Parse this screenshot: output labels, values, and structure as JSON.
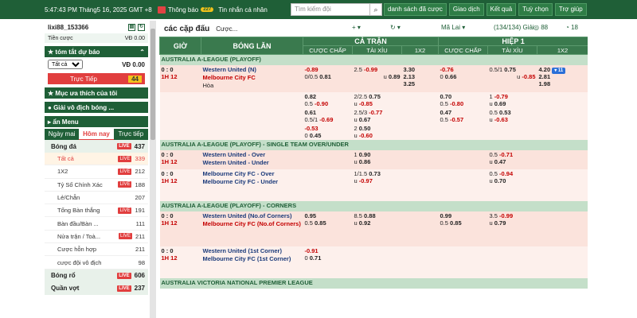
{
  "topbar": {
    "time": "5:47:43 PM Tháng5 16, 2025 GMT +8",
    "notif": "Thông báo",
    "notif_count": "227",
    "msg": "Tin nhắn cá nhân",
    "search_ph": "Tìm kiếm đội",
    "nav": [
      "danh sách đã cược",
      "Giao dịch",
      "Kết quả",
      "Tuỳ chọn",
      "Trợ giúp"
    ]
  },
  "account": {
    "user": "lixi88_153366",
    "credit_label": "Tiền cược",
    "credit_value": "VĐ 0.00"
  },
  "slip": {
    "title": "tóm tắt dự báo",
    "select": "Tất cả",
    "value": "VĐ 0.00",
    "live_label": "Trực Tiếp",
    "live_count": "44"
  },
  "sections": {
    "fav": "Mục ưa thích của tôi",
    "champ": "Giải vô địch bóng ...",
    "menu": "ẩn Menu"
  },
  "tabs": [
    "Ngày mai",
    "Hôm nay",
    "Trực tiếp"
  ],
  "sports": [
    {
      "name": "Bóng đá",
      "count": "437"
    },
    {
      "name": "Bóng rổ",
      "count": "606"
    },
    {
      "name": "Quần vợt",
      "count": "237"
    }
  ],
  "subs": [
    {
      "name": "Tất cả",
      "count": "339",
      "live": true
    },
    {
      "name": "1X2",
      "count": "212",
      "live": true
    },
    {
      "name": "Tỷ Số Chính Xác",
      "count": "188",
      "live": true
    },
    {
      "name": "Lẻ/Chẵn",
      "count": "207",
      "live": false
    },
    {
      "name": "Tổng Bàn thắng",
      "count": "191",
      "live": true
    },
    {
      "name": "Bàn đầu/Bàn ...",
      "count": "111",
      "live": false
    },
    {
      "name": "Nửa trận / Toà...",
      "count": "211",
      "live": true
    },
    {
      "name": "Cược hỗn hợp",
      "count": "211",
      "live": false
    },
    {
      "name": "cược đội vô địch",
      "count": "98",
      "live": false
    }
  ],
  "main": {
    "title": "các cặp đấu",
    "cuoc": "Cược...",
    "odds": "Mã Lai",
    "total": "(134/134) Giải",
    "live": "88",
    "fav": "18"
  },
  "headers": {
    "time": "GIỜ",
    "match": "BÓNG LĂN",
    "full": "CẢ TRẬN",
    "half": "HIỆP 1",
    "hdp": "CƯỢC CHẤP",
    "ou": "TÀI XỈU",
    "x12": "1X2"
  },
  "leagues": [
    "AUSTRALIA A-LEAGUE (PLAYOFF)",
    "AUSTRALIA A-LEAGUE (PLAYOFF) - SINGLE TEAM OVER/UNDER",
    "AUSTRALIA A-LEAGUE (PLAYOFF) - CORNERS",
    "AUSTRALIA VICTORIA NATIONAL PREMIER LEAGUE"
  ],
  "m1": {
    "score": "0 : 0",
    "time": "1H 12",
    "home": "Western United (N)",
    "away": "Melbourne City FC",
    "draw": "Hòa"
  },
  "m2": {
    "score": "0 : 0",
    "time": "1H 12",
    "home": "Western United - Over",
    "away": "Western United - Under"
  },
  "m3": {
    "score": "0 : 0",
    "time": "1H 12",
    "home": "Melbourne City FC - Over",
    "away": "Melbourne City FC - Under"
  },
  "m4": {
    "score": "0 : 0",
    "time": "1H 12",
    "home": "Western United (No.of Corners)",
    "away": "Melbourne City FC (No.of Corners)"
  },
  "m5": {
    "score": "0 : 0",
    "time": "1H 12",
    "home": "Western United (1st Corner)",
    "away": "Melbourne City FC (1st Corner)"
  }
}
